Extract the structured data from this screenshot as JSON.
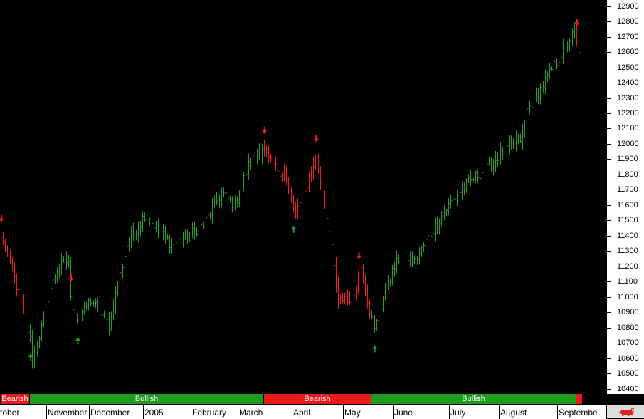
{
  "chart_data": {
    "type": "ohlc",
    "title": "",
    "ylim": [
      10380,
      12940
    ],
    "y_ticks": [
      10400,
      10500,
      10600,
      10700,
      10800,
      10900,
      11000,
      11100,
      11200,
      11300,
      11400,
      11500,
      11600,
      11700,
      11800,
      11900,
      12000,
      12100,
      12200,
      12300,
      12400,
      12500,
      12600,
      12700,
      12800,
      12900
    ],
    "x_labels": [
      "tober",
      "November",
      "December",
      "2005",
      "February",
      "March",
      "April",
      "May",
      "June",
      "July",
      "August",
      "Septembe"
    ],
    "x_label_bar_index": [
      0,
      21,
      40,
      64,
      85,
      106,
      130,
      153,
      175,
      200,
      222,
      248
    ],
    "bar_count": 270,
    "colors": {
      "bullish": "#2a9a2a",
      "bearish": "#e82020",
      "band_bull": "#1e9a1e",
      "band_bear": "#e81a1a"
    },
    "anchor_closes": [
      [
        0,
        11390
      ],
      [
        2,
        11320
      ],
      [
        8,
        11020
      ],
      [
        13,
        10720
      ],
      [
        14,
        10590
      ],
      [
        18,
        10800
      ],
      [
        22,
        11060
      ],
      [
        26,
        11200
      ],
      [
        30,
        11240
      ],
      [
        31,
        10980
      ],
      [
        34,
        10860
      ],
      [
        40,
        10980
      ],
      [
        48,
        10820
      ],
      [
        56,
        11340
      ],
      [
        64,
        11540
      ],
      [
        68,
        11470
      ],
      [
        76,
        11340
      ],
      [
        82,
        11390
      ],
      [
        90,
        11470
      ],
      [
        98,
        11680
      ],
      [
        104,
        11600
      ],
      [
        110,
        11860
      ],
      [
        116,
        11980
      ],
      [
        120,
        11870
      ],
      [
        126,
        11800
      ],
      [
        131,
        11520
      ],
      [
        136,
        11730
      ],
      [
        140,
        11900
      ],
      [
        145,
        11540
      ],
      [
        150,
        10960
      ],
      [
        154,
        11020
      ],
      [
        156,
        10960
      ],
      [
        160,
        11200
      ],
      [
        166,
        10780
      ],
      [
        172,
        11100
      ],
      [
        178,
        11280
      ],
      [
        184,
        11230
      ],
      [
        192,
        11440
      ],
      [
        200,
        11620
      ],
      [
        208,
        11750
      ],
      [
        216,
        11840
      ],
      [
        224,
        11960
      ],
      [
        232,
        12040
      ],
      [
        234,
        12220
      ],
      [
        240,
        12360
      ],
      [
        246,
        12510
      ],
      [
        250,
        12610
      ],
      [
        255,
        12730
      ],
      [
        258,
        12510
      ]
    ],
    "signals": [
      {
        "bar": 0,
        "direction": "down"
      },
      {
        "bar": 13,
        "direction": "up"
      },
      {
        "bar": 31,
        "direction": "down"
      },
      {
        "bar": 34,
        "direction": "up"
      },
      {
        "bar": 117,
        "direction": "down"
      },
      {
        "bar": 130,
        "direction": "up"
      },
      {
        "bar": 140,
        "direction": "down"
      },
      {
        "bar": 159,
        "direction": "down"
      },
      {
        "bar": 166,
        "direction": "up"
      },
      {
        "bar": 256,
        "direction": "down"
      }
    ],
    "regimes": [
      {
        "label": "Bearish",
        "start_bar": 0,
        "end_bar": 13,
        "state": "bearish"
      },
      {
        "label": "Bullish",
        "start_bar": 13,
        "end_bar": 117,
        "state": "bullish"
      },
      {
        "label": "Bearish",
        "start_bar": 117,
        "end_bar": 165,
        "state": "bearish"
      },
      {
        "label": "Bullish",
        "start_bar": 165,
        "end_bar": 256,
        "state": "bullish"
      },
      {
        "label": "",
        "start_bar": 256,
        "end_bar": 259,
        "state": "bearish"
      }
    ]
  }
}
